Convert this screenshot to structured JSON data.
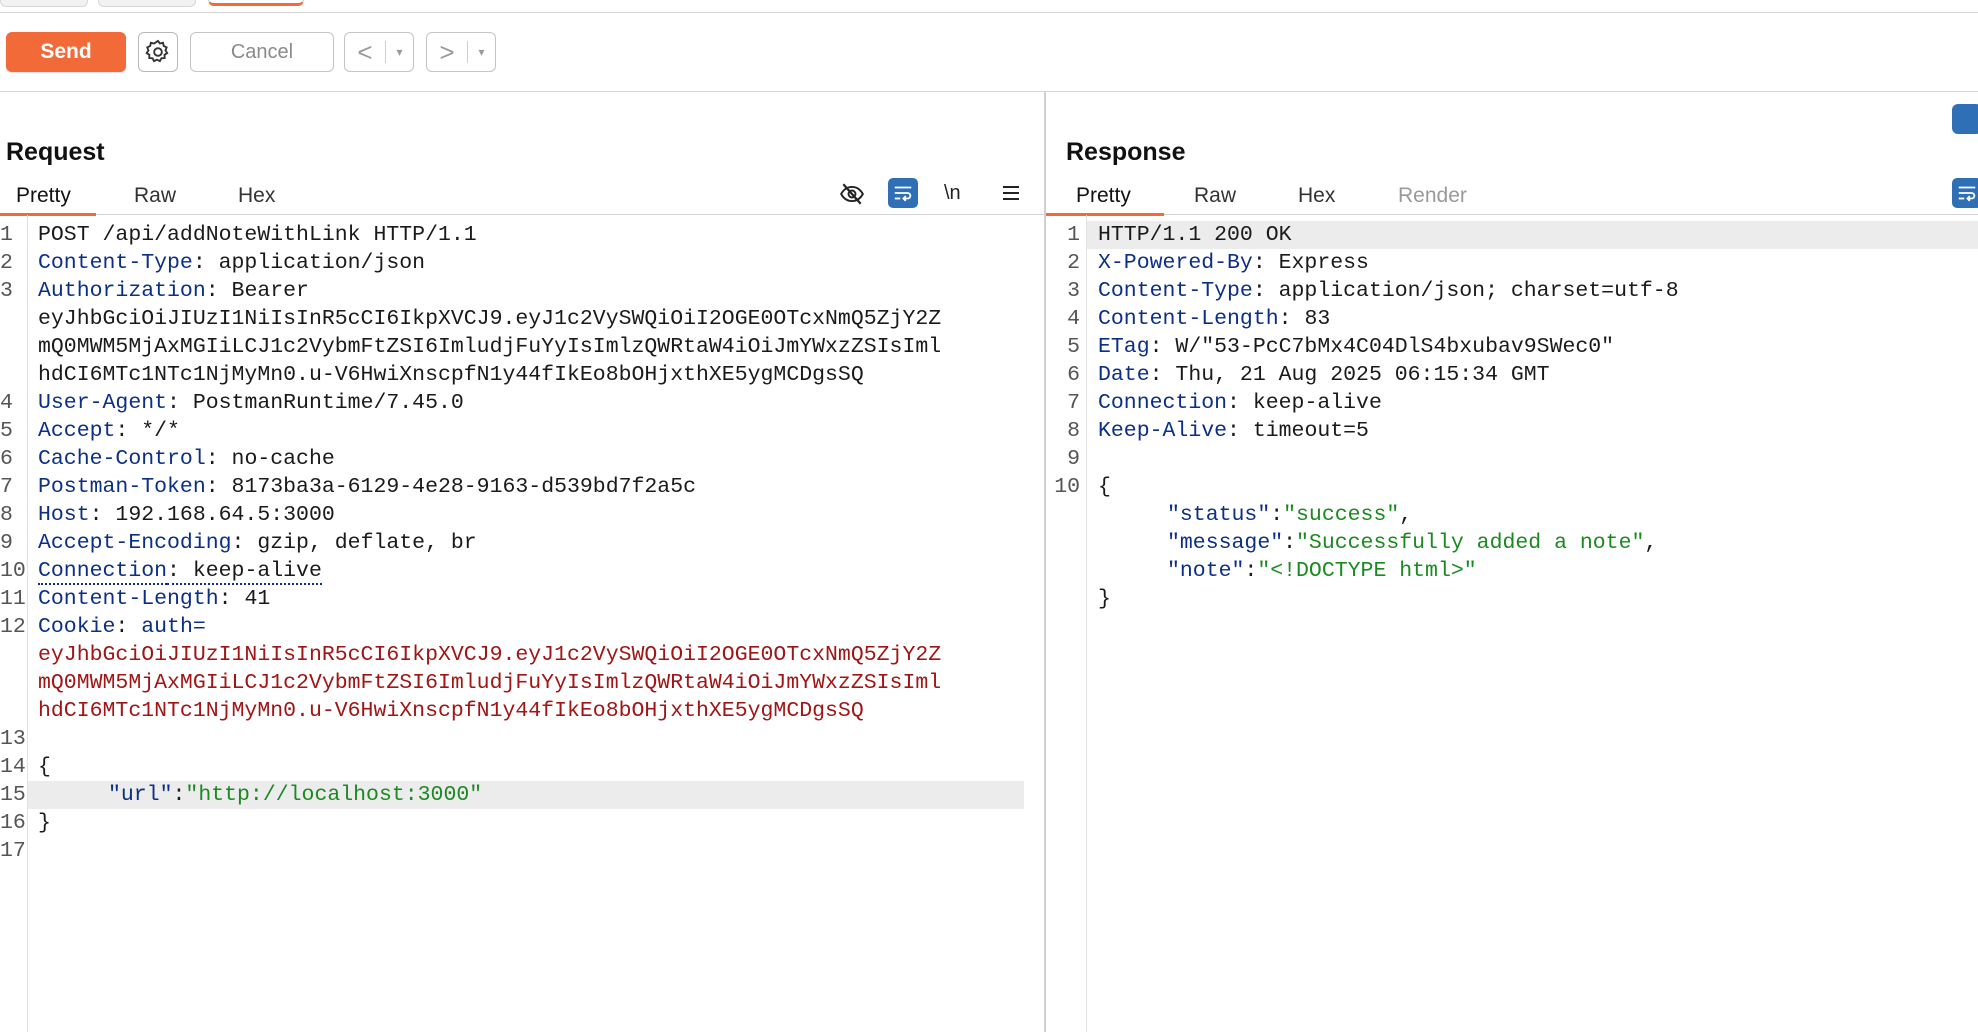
{
  "toolbar": {
    "send_label": "Send",
    "cancel_label": "Cancel",
    "back_glyph": "<",
    "forward_glyph": ">",
    "dropdown_glyph": "▾"
  },
  "request": {
    "title": "Request",
    "tabs": [
      "Pretty",
      "Raw",
      "Hex"
    ],
    "active_tab": "Pretty",
    "newline_toggle": "\\n",
    "lines": {
      "l1": "POST /api/addNoteWithLink HTTP/1.1",
      "l2_key": "Content-Type",
      "l2_val": ": application/json",
      "l3_key": "Authorization",
      "l3_val": ": Bearer",
      "l3_wrap1": "eyJhbGciOiJIUzI1NiIsInR5cCI6IkpXVCJ9.eyJ1c2VySWQiOiI2OGE0OTcxNmQ5ZjY2Z",
      "l3_wrap2": "mQ0MWM5MjAxMGIiLCJ1c2VybmFtZSI6ImludjFuYyIsImlzQWRtaW4iOiJmYWxzZSIsIml",
      "l3_wrap3": "hdCI6MTc1NTc1NjMyMn0.u-V6HwiXnscpfN1y44fIkEo8bOHjxthXE5ygMCDgsSQ",
      "l4_key": "User-Agent",
      "l4_val": ": PostmanRuntime/7.45.0",
      "l5_key": "Accept",
      "l5_val": ": */*",
      "l6_key": "Cache-Control",
      "l6_val": ": no-cache",
      "l7_key": "Postman-Token",
      "l7_val": ": 8173ba3a-6129-4e28-9163-d539bd7f2a5c",
      "l8_key": "Host",
      "l8_val": ": 192.168.64.5:3000",
      "l9_key": "Accept-Encoding",
      "l9_val": ": gzip, deflate, br",
      "l10_key": "Connection",
      "l10_val": ": keep-alive",
      "l11_key": "Content-Length",
      "l11_val": ": 41",
      "l12_key": "Cookie",
      "l12_mid": ": ",
      "l12_val": "auth=",
      "l12_wrap1": "eyJhbGciOiJIUzI1NiIsInR5cCI6IkpXVCJ9.eyJ1c2VySWQiOiI2OGE0OTcxNmQ5ZjY2Z",
      "l12_wrap2": "mQ0MWM5MjAxMGIiLCJ1c2VybmFtZSI6ImludjFuYyIsImlzQWRtaW4iOiJmYWxzZSIsIml",
      "l12_wrap3": "hdCI6MTc1NTc1NjMyMn0.u-V6HwiXnscpfN1y44fIkEo8bOHjxthXE5ygMCDgsSQ",
      "l14": "{",
      "l15_key": "\"url\"",
      "l15_colon": ":",
      "l15_val": "\"http://localhost:3000\"",
      "l16": "}"
    },
    "line_numbers": [
      "1",
      "2",
      "3",
      "4",
      "5",
      "6",
      "7",
      "8",
      "9",
      "10",
      "11",
      "12",
      "13",
      "14",
      "15",
      "16",
      "17"
    ]
  },
  "response": {
    "title": "Response",
    "tabs": [
      "Pretty",
      "Raw",
      "Hex",
      "Render"
    ],
    "active_tab": "Pretty",
    "lines": {
      "l1": "HTTP/1.1 200 OK",
      "l2_key": "X-Powered-By",
      "l2_val": ": Express",
      "l3_key": "Content-Type",
      "l3_val": ": application/json; charset=utf-8",
      "l4_key": "Content-Length",
      "l4_val": ": 83",
      "l5_key": "ETag",
      "l5_val": ": W/\"53-PcC7bMx4C04DlS4bxubav9SWec0\"",
      "l6_key": "Date",
      "l6_val": ": Thu, 21 Aug 2025 06:15:34 GMT",
      "l7_key": "Connection",
      "l7_val": ": keep-alive",
      "l8_key": "Keep-Alive",
      "l8_val": ": timeout=5",
      "l10": "{",
      "j1_key": "\"status\"",
      "j1_val": "\"success\"",
      "j1_end": ",",
      "j2_key": "\"message\"",
      "j2_val": "\"Successfully added a note\"",
      "j2_end": ",",
      "j3_key": "\"note\"",
      "j3_val": "\"<!DOCTYPE html>\"",
      "close": "}",
      "colon": ":"
    },
    "line_numbers": [
      "1",
      "2",
      "3",
      "4",
      "5",
      "6",
      "7",
      "8",
      "9",
      "10"
    ]
  },
  "colors": {
    "accent": "#f26a37",
    "header_key": "#0c2f86",
    "cookie_value": "#a01515",
    "json_value": "#1a8a20",
    "toggle_active": "#2f6fb5"
  }
}
